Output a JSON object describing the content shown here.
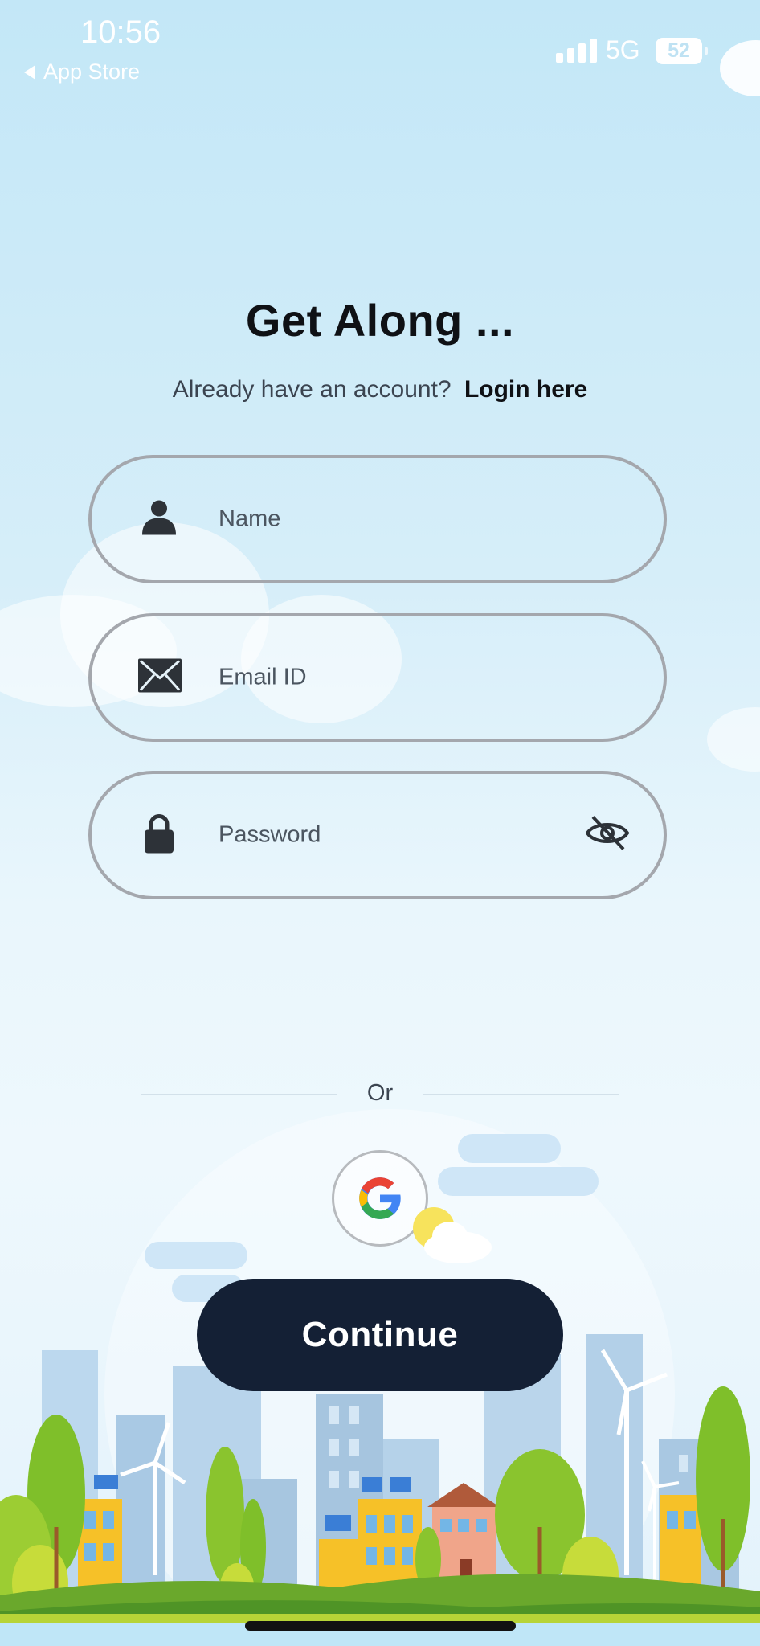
{
  "status_bar": {
    "time": "10:56",
    "back_label": "App Store",
    "network": "5G",
    "battery": "52"
  },
  "header": {
    "title": "Get Along ...",
    "subtitle": "Already have an account?",
    "login_link": "Login here"
  },
  "form": {
    "name_placeholder": "Name",
    "email_placeholder": "Email ID",
    "password_placeholder": "Password",
    "icons": [
      "person-icon",
      "envelope-icon",
      "lock-icon",
      "eye-slash-icon"
    ]
  },
  "divider": {
    "label": "Or"
  },
  "social": {
    "provider": "google-icon"
  },
  "actions": {
    "continue_label": "Continue"
  },
  "colors": {
    "primary_button": "#142035",
    "field_border": "#a4a7ad",
    "sky": "#c3e7f7"
  }
}
